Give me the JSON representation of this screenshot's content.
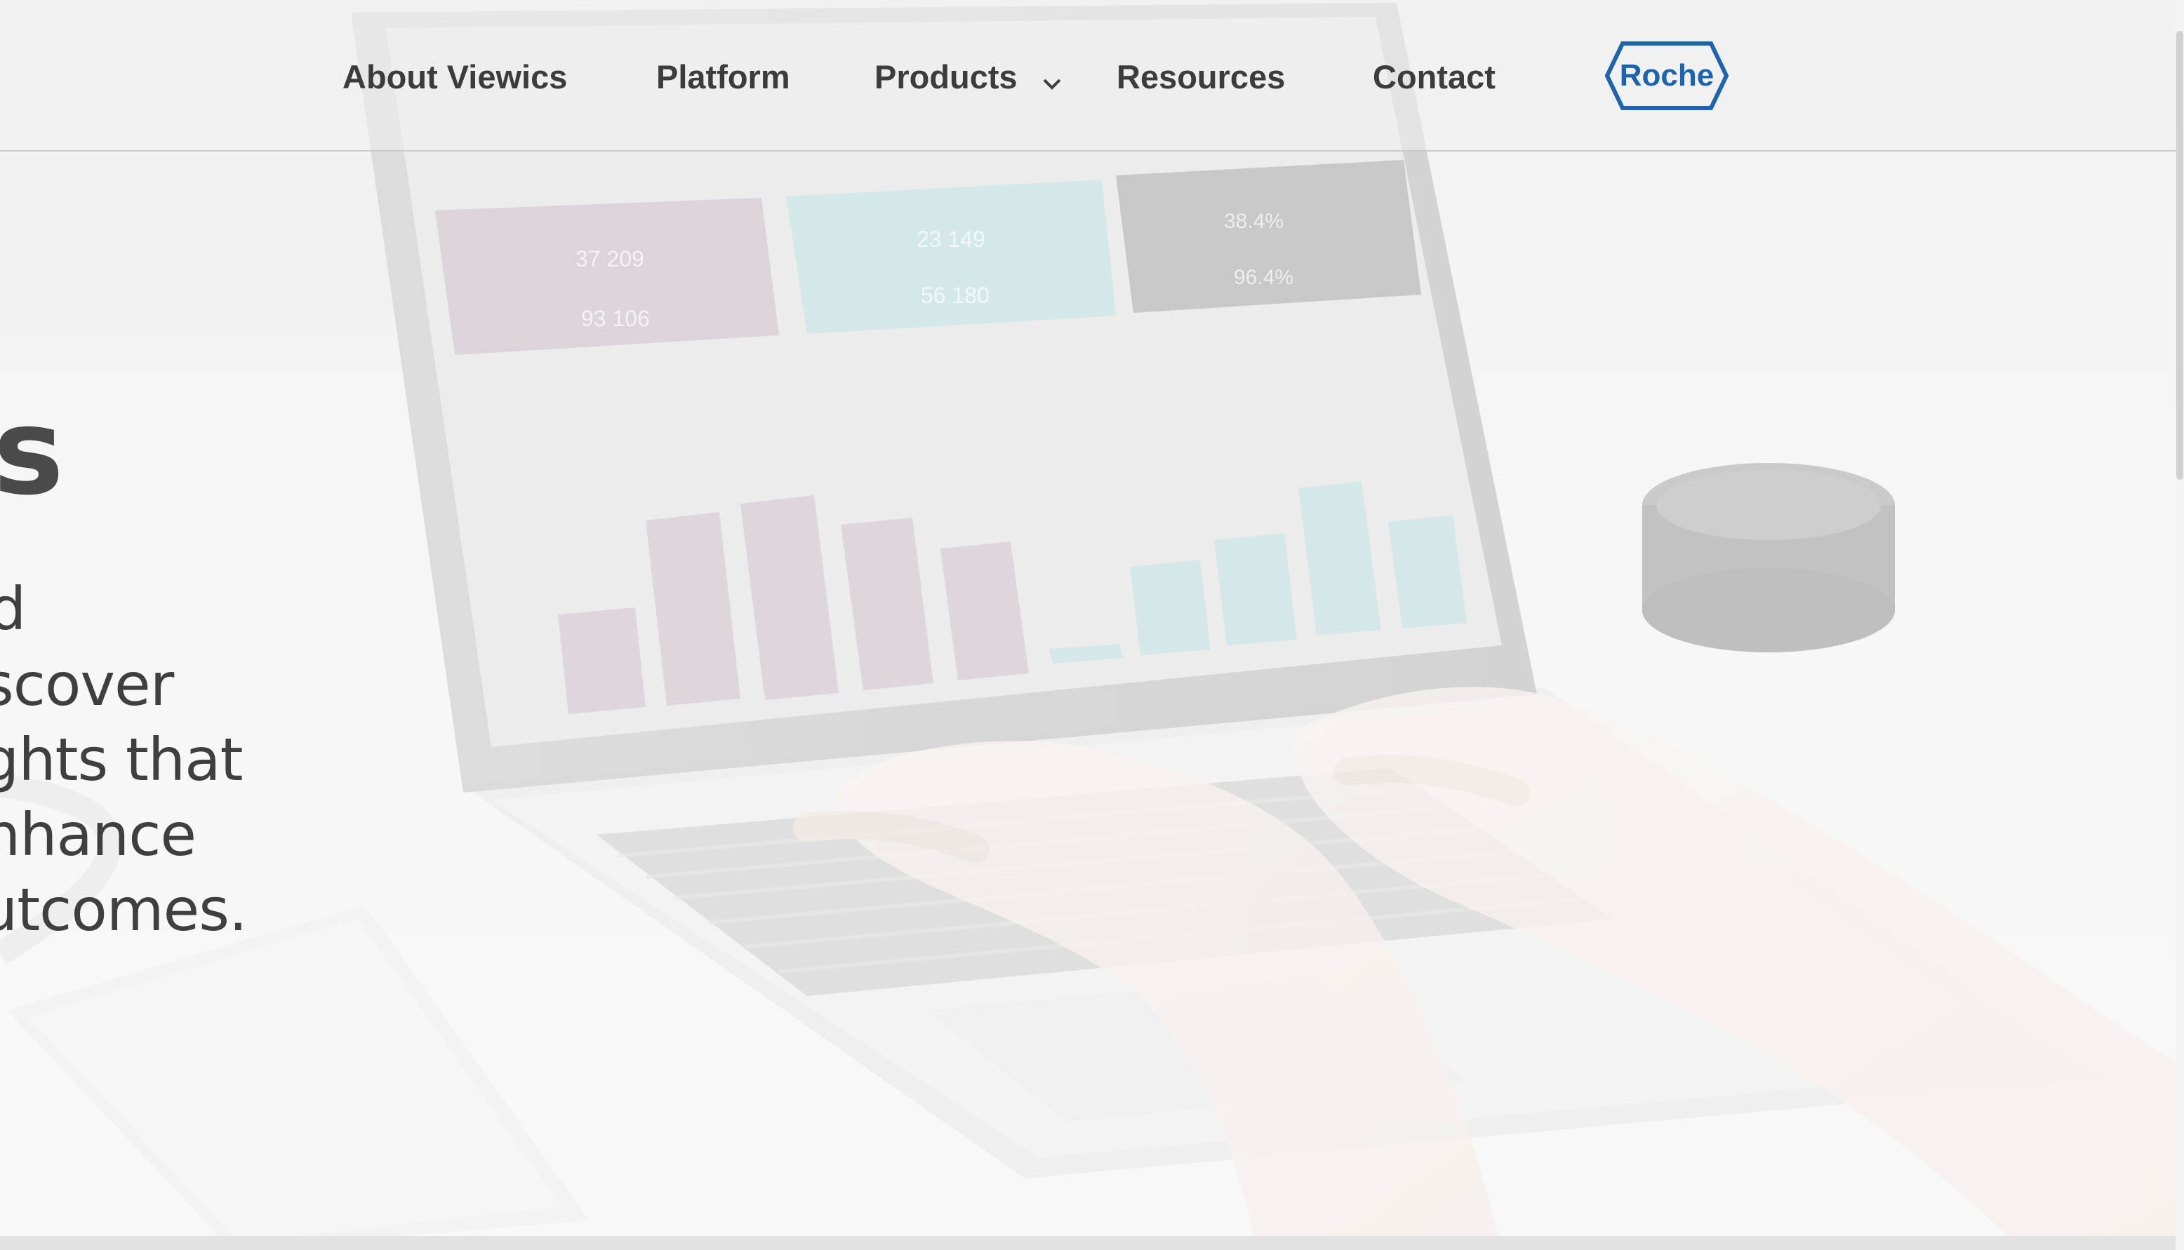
{
  "nav": {
    "items": [
      {
        "label": "About Viewics"
      },
      {
        "label": "Platform"
      },
      {
        "label": "Products"
      },
      {
        "label": "Resources"
      },
      {
        "label": "Contact"
      }
    ],
    "logo_text": "Roche"
  },
  "hero": {
    "heading": "s",
    "lines": [
      "d",
      "scover",
      "ghts that",
      "nhance",
      "utcomes."
    ]
  },
  "colors": {
    "nav_text": "#3c3c3c",
    "logo_blue": "#1e63b0",
    "bar_purple": "#c9b4c6",
    "bar_teal": "#bcdfe2",
    "card_dark": "#8f8f8f"
  }
}
